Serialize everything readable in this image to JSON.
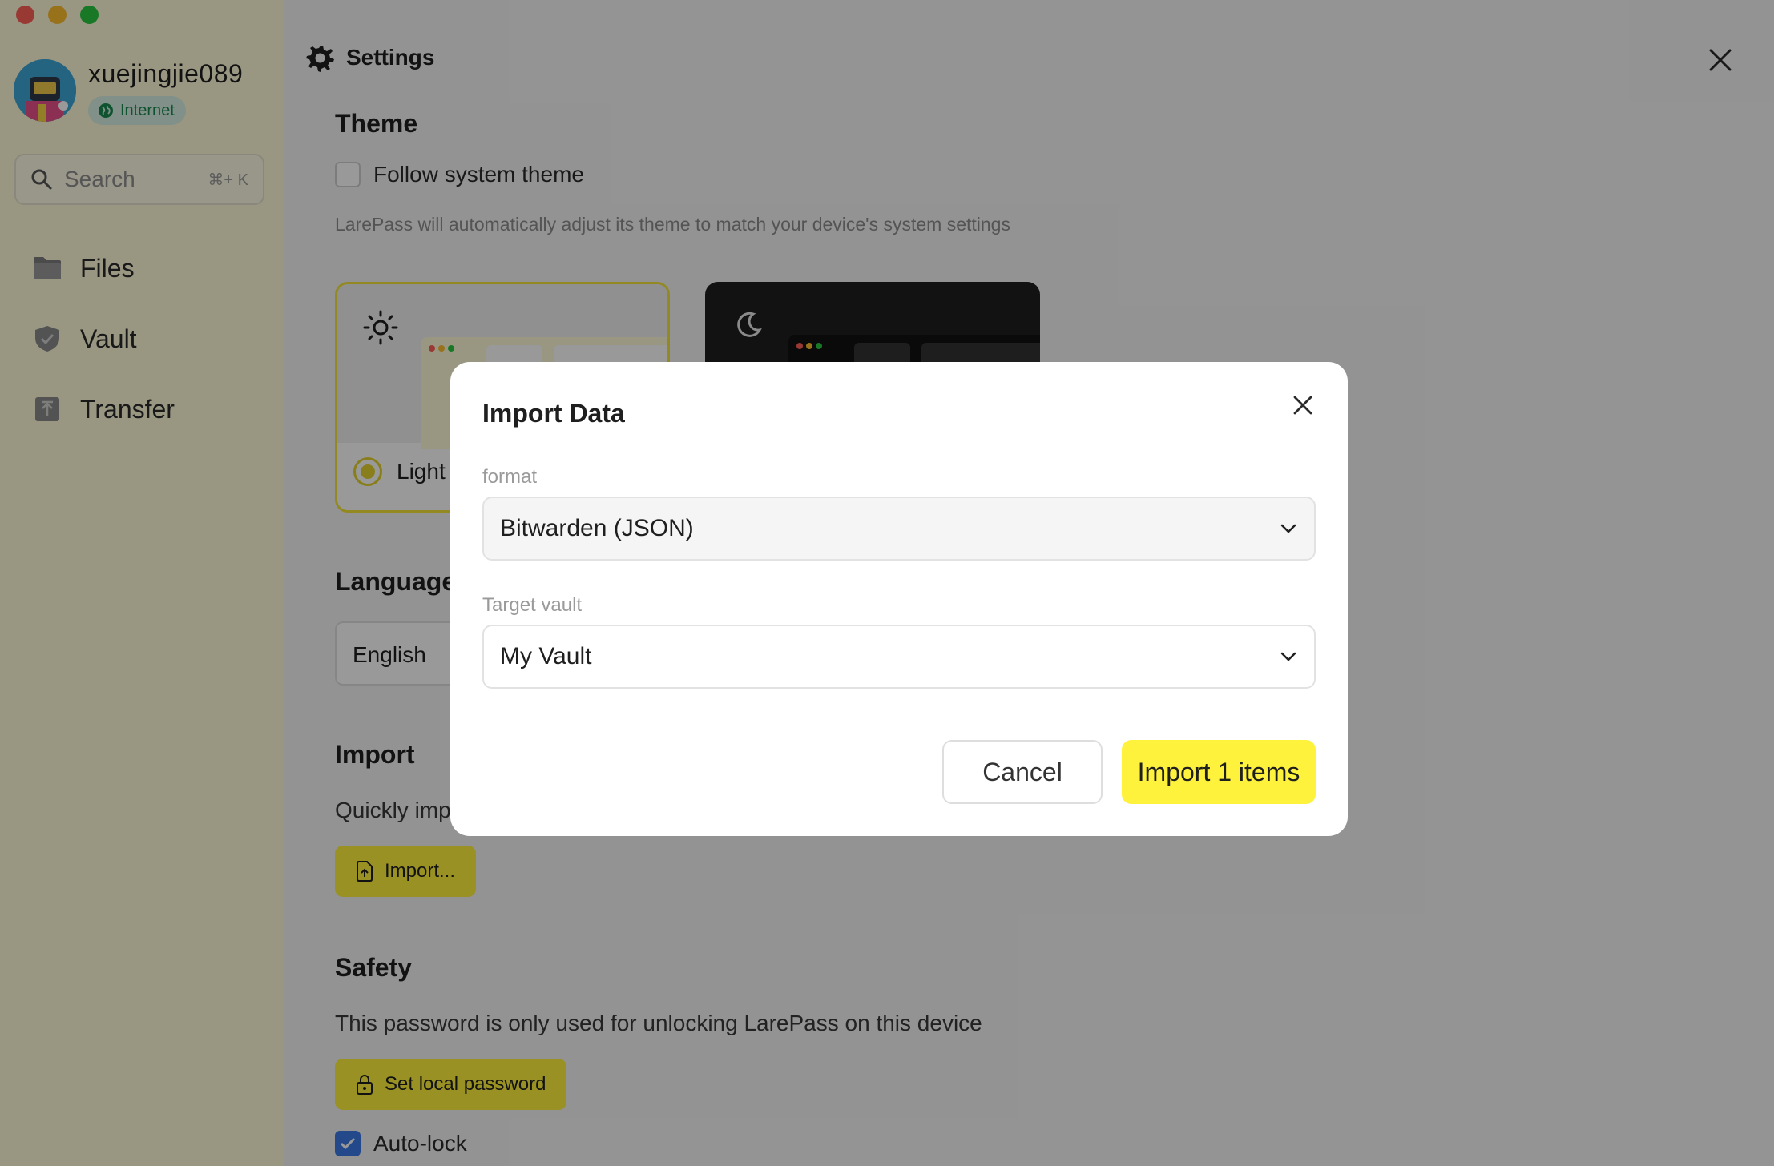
{
  "window": {
    "traffic_lights": [
      "#ff5f57",
      "#febc2e",
      "#28c840"
    ]
  },
  "sidebar": {
    "username": "xuejingjie089",
    "network_badge": "Internet",
    "search": {
      "placeholder": "Search",
      "shortcut": "⌘+ K"
    },
    "items": [
      {
        "label": "Files",
        "icon": "folder-icon"
      },
      {
        "label": "Vault",
        "icon": "shield-icon"
      },
      {
        "label": "Transfer",
        "icon": "upload-icon"
      }
    ]
  },
  "settings": {
    "title": "Settings",
    "theme": {
      "heading": "Theme",
      "follow_system_label": "Follow system theme",
      "follow_system_checked": false,
      "hint": "LarePass will automatically adjust its theme to match your device's system settings",
      "light_label": "Light",
      "selected": "Light"
    },
    "language": {
      "heading": "Language",
      "value": "English"
    },
    "import": {
      "heading": "Import",
      "description": "Quickly imp",
      "button_label": "Import..."
    },
    "safety": {
      "heading": "Safety",
      "description": "This password is only used for unlocking LarePass on this device",
      "button_label": "Set local password",
      "autolock_label": "Auto-lock",
      "autolock_checked": true
    }
  },
  "dialog": {
    "title": "Import Data",
    "format_label": "format",
    "format_value": "Bitwarden (JSON)",
    "target_label": "Target vault",
    "target_value": "My Vault",
    "cancel_label": "Cancel",
    "confirm_label": "Import 1 items"
  },
  "colors": {
    "accent": "#fff23d",
    "sidebar_bg": "#fffbd8",
    "badge_bg": "#d7f1e3",
    "badge_text": "#19894f",
    "checkbox_checked": "#3b7ae8"
  }
}
